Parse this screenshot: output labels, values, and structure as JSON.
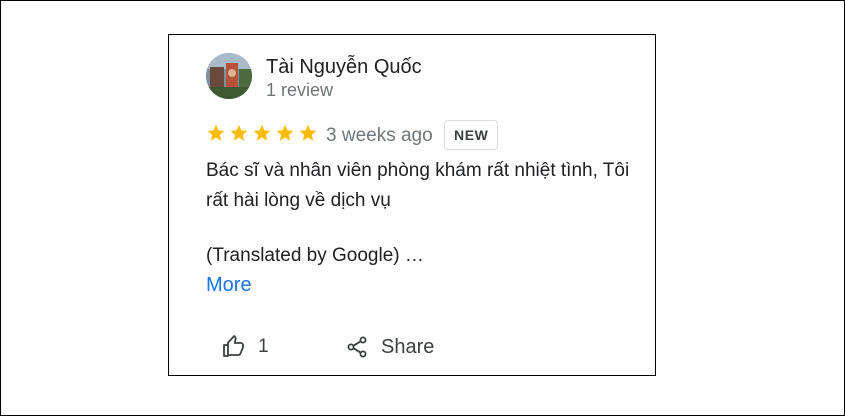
{
  "review": {
    "reviewer_name": "Tài Nguyễn Quốc",
    "review_count": "1 review",
    "rating": 5,
    "rating_max": 5,
    "time_ago": "3 weeks ago",
    "badge": "NEW",
    "text": "Bác sĩ và nhân viên phòng khám rất nhiệt tình, Tôi rất hài lòng về dịch vụ",
    "translated": "(Translated by Google) …",
    "more_label": "More"
  },
  "actions": {
    "like_count": "1",
    "share_label": "Share"
  },
  "colors": {
    "star": "#fbbc04",
    "link": "#1a73e8",
    "muted": "#70757a",
    "text": "#202124"
  },
  "icons": {
    "like": "thumbs-up-icon",
    "share": "share-icon",
    "star": "star-icon"
  }
}
